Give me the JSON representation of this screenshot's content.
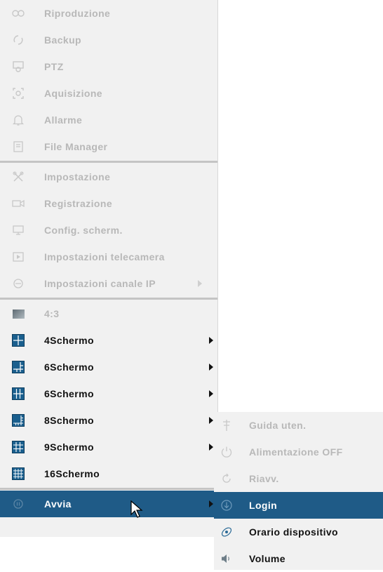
{
  "main_menu": {
    "group1": [
      {
        "label": "Riproduzione",
        "icon": "playback-icon"
      },
      {
        "label": "Backup",
        "icon": "backup-icon"
      },
      {
        "label": "PTZ",
        "icon": "ptz-icon"
      },
      {
        "label": "Aquisizione",
        "icon": "capture-icon"
      },
      {
        "label": "Allarme",
        "icon": "bell-icon"
      },
      {
        "label": "File Manager",
        "icon": "file-manager-icon"
      }
    ],
    "group2": [
      {
        "label": "Impostazione",
        "icon": "settings-tools-icon"
      },
      {
        "label": "Registrazione",
        "icon": "record-icon"
      },
      {
        "label": "Config. scherm.",
        "icon": "monitor-icon"
      },
      {
        "label": "Impostazioni telecamera",
        "icon": "camera-settings-icon"
      },
      {
        "label": "Impostazioni canale IP",
        "icon": "ip-channel-icon"
      }
    ],
    "group3": [
      {
        "label": "4:3",
        "icon": "aspect-ratio-icon"
      },
      {
        "label": "4Schermo",
        "icon": "grid-4-icon"
      },
      {
        "label": "6Schermo",
        "icon": "grid-6a-icon"
      },
      {
        "label": "6Schermo",
        "icon": "grid-6b-icon"
      },
      {
        "label": "8Schermo",
        "icon": "grid-8-icon"
      },
      {
        "label": "9Schermo",
        "icon": "grid-9-icon"
      },
      {
        "label": "16Schermo",
        "icon": "grid-16-icon"
      }
    ],
    "start": {
      "label": "Avvia",
      "icon": "start-icon"
    }
  },
  "start_submenu": [
    {
      "label": "Guida uten.",
      "icon": "guide-icon"
    },
    {
      "label": "Alimentazione OFF",
      "icon": "power-icon"
    },
    {
      "label": "Riavv.",
      "icon": "restart-icon"
    },
    {
      "label": "Login",
      "icon": "login-icon"
    },
    {
      "label": "Orario dispositivo",
      "icon": "clock-icon"
    },
    {
      "label": "Volume",
      "icon": "volume-icon"
    }
  ],
  "colors": {
    "highlight": "#1f5b87",
    "menu_bg": "#f1f1f1",
    "disabled_text": "#b8b8b8"
  }
}
